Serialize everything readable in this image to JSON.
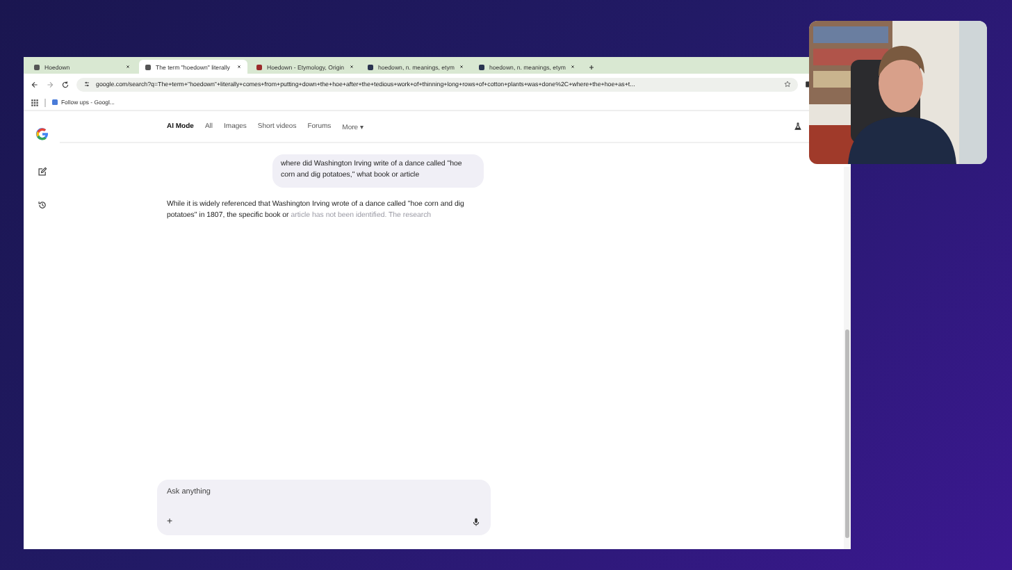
{
  "browser": {
    "tabs": [
      {
        "title": "Hoedown",
        "selected": false
      },
      {
        "title": "The term \"hoedown\" literally",
        "selected": true
      },
      {
        "title": "Hoedown - Etymology, Origin",
        "selected": false
      },
      {
        "title": "hoedown, n. meanings, etym",
        "selected": false
      },
      {
        "title": "hoedown, n. meanings, etym",
        "selected": false
      }
    ],
    "address": "google.com/search?q=The+term+\"hoedown\"+literally+comes+from+putting+down+the+hoe+after+the+tedious+work+of+thinning+long+rows+of+cotton+plants+was+done%2C+where+the+hoe+as+t...",
    "bookmarks": [
      "Follow ups - Googl..."
    ]
  },
  "nav": [
    {
      "label": "AI Mode",
      "selected": true
    },
    {
      "label": "All",
      "selected": false
    },
    {
      "label": "Images",
      "selected": false
    },
    {
      "label": "Short videos",
      "selected": false
    },
    {
      "label": "Forums",
      "selected": false
    },
    {
      "label": "More ▾",
      "selected": false
    }
  ],
  "query": "where did Washington Irving write of a dance called \"hoe corn and dig potatoes,\" what book or article",
  "answer": {
    "text": "While it is widely referenced that Washington Irving wrote of a dance called \"hoe corn and dig potatoes\" in 1807, the specific book or",
    "faded_text": "article has not been identified. The research"
  },
  "input": {
    "placeholder": "Ask anything",
    "plus": "+"
  }
}
